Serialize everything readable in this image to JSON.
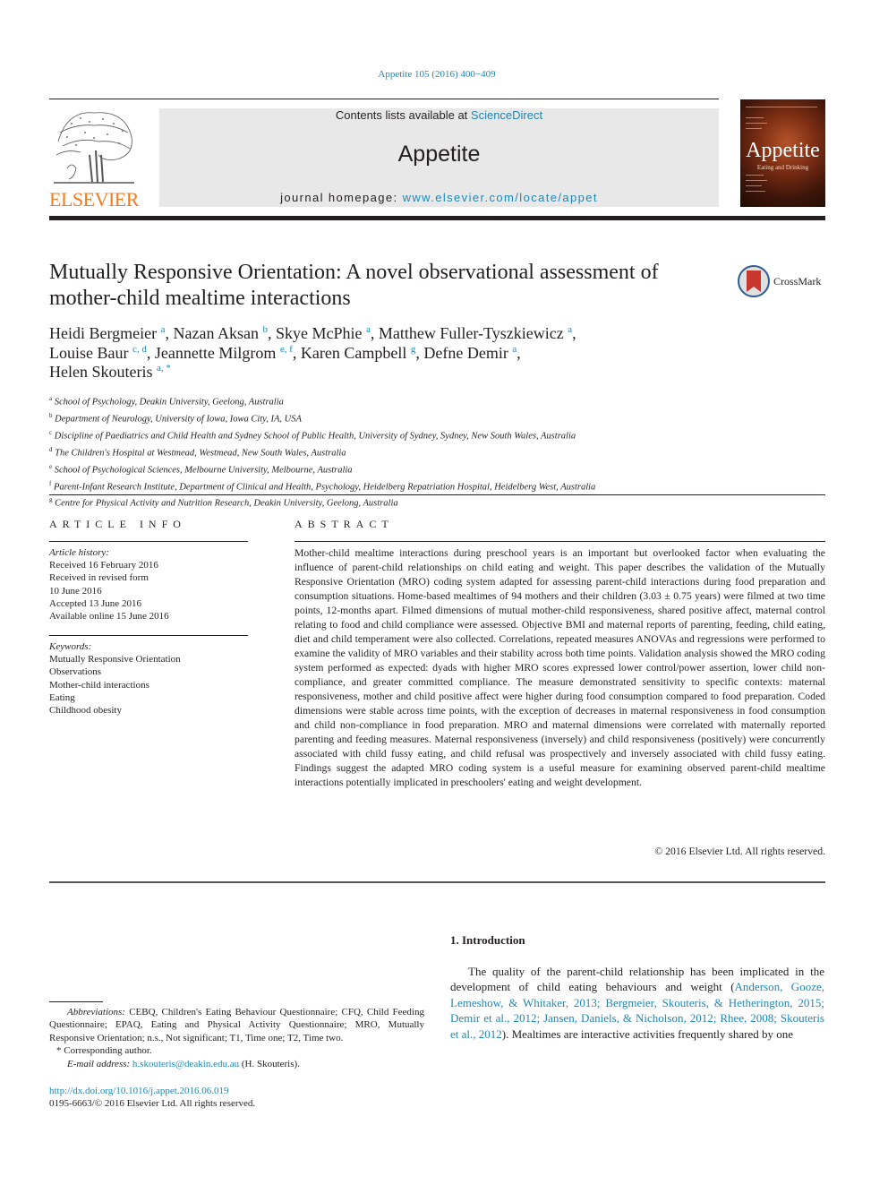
{
  "header": {
    "citation": "Appetite 105 (2016) 400−409",
    "contents_prefix": "Contents lists available at ",
    "contents_link": "ScienceDirect",
    "journal_name": "Appetite",
    "homepage_prefix": "journal homepage: ",
    "homepage_link": "www.elsevier.com/locate/appet",
    "publisher_logo_text": "ELSEVIER",
    "cover_title": "Appetite",
    "cover_subtitle": "Eating and Drinking"
  },
  "article": {
    "title": "Mutually Responsive Orientation: A novel observational assessment of mother-child mealtime interactions",
    "crossmark_label": "CrossMark",
    "authors": [
      {
        "name": "Heidi Bergmeier",
        "sup": "a",
        "sep": ", "
      },
      {
        "name": "Nazan Aksan",
        "sup": "b",
        "sep": ", "
      },
      {
        "name": "Skye McPhie",
        "sup": "a",
        "sep": ", "
      },
      {
        "name": "Matthew Fuller-Tyszkiewicz",
        "sup": "a",
        "sep": ","
      },
      {
        "name": "Louise Baur",
        "sup": "c, d",
        "sep": ", "
      },
      {
        "name": "Jeannette Milgrom",
        "sup": "e, f",
        "sep": ", "
      },
      {
        "name": "Karen Campbell",
        "sup": "g",
        "sep": ", "
      },
      {
        "name": "Defne Demir",
        "sup": "a",
        "sep": ","
      },
      {
        "name": "Helen Skouteris",
        "sup": "a, *",
        "sep": ""
      }
    ],
    "affiliations": [
      {
        "key": "a",
        "text": "School of Psychology, Deakin University, Geelong, Australia"
      },
      {
        "key": "b",
        "text": "Department of Neurology, University of Iowa, Iowa City, IA, USA"
      },
      {
        "key": "c",
        "text": "Discipline of Paediatrics and Child Health and Sydney School of Public Health, University of Sydney, Sydney, New South Wales, Australia"
      },
      {
        "key": "d",
        "text": "The Children's Hospital at Westmead, Westmead, New South Wales, Australia"
      },
      {
        "key": "e",
        "text": "School of Psychological Sciences, Melbourne University, Melbourne, Australia"
      },
      {
        "key": "f",
        "text": "Parent-Infant Research Institute, Department of Clinical and Health, Psychology, Heidelberg Repatriation Hospital, Heidelberg West, Australia"
      },
      {
        "key": "g",
        "text": "Centre for Physical Activity and Nutrition Research, Deakin University, Geelong, Australia"
      }
    ]
  },
  "article_info": {
    "heading": "ARTICLE INFO",
    "history_label": "Article history:",
    "history": [
      "Received 16 February 2016",
      "Received in revised form",
      "10 June 2016",
      "Accepted 13 June 2016",
      "Available online 15 June 2016"
    ],
    "keywords_label": "Keywords:",
    "keywords": [
      "Mutually Responsive Orientation",
      "Observations",
      "Mother-child interactions",
      "Eating",
      "Childhood obesity"
    ]
  },
  "abstract": {
    "heading": "ABSTRACT",
    "text": "Mother-child mealtime interactions during preschool years is an important but overlooked factor when evaluating the influence of parent-child relationships on child eating and weight. This paper describes the validation of the Mutually Responsive Orientation (MRO) coding system adapted for assessing parent-child interactions during food preparation and consumption situations. Home-based mealtimes of 94 mothers and their children (3.03 ± 0.75 years) were filmed at two time points, 12-months apart. Filmed dimensions of mutual mother-child responsiveness, shared positive affect, maternal control relating to food and child compliance were assessed. Objective BMI and maternal reports of parenting, feeding, child eating, diet and child temperament were also collected. Correlations, repeated measures ANOVAs and regressions were performed to examine the validity of MRO variables and their stability across both time points. Validation analysis showed the MRO coding system performed as expected: dyads with higher MRO scores expressed lower control/power assertion, lower child non-compliance, and greater committed compliance. The measure demonstrated sensitivity to specific contexts: maternal responsiveness, mother and child positive affect were higher during food consumption compared to food preparation. Coded dimensions were stable across time points, with the exception of decreases in maternal responsiveness in food consumption and child non-compliance in food prepara­tion. MRO and maternal dimensions were correlated with maternally reported parenting and feeding measures. Maternal responsiveness (inversely) and child responsiveness (positively) were concurrently associated with child fussy eating, and child refusal was prospectively and inversely associated with child fussy eating. Findings suggest the adapted MRO coding system is a useful measure for examining observed parent-child mealtime interactions potentially implicated in preschoolers' eating and weight development.",
    "copyright": "© 2016 Elsevier Ltd. All rights reserved."
  },
  "footnotes": {
    "abbreviations_label": "Abbreviations:",
    "abbreviations_text": " CEBQ, Children's Eating Behaviour Questionnaire; CFQ, Child Feeding Questionnaire; EPAQ, Eating and Physical Activity Questionnaire; MRO, Mutually Responsive Orientation; n.s., Not significant; T1, Time one; T2, Time two.",
    "corresponding": "* Corresponding author.",
    "email_label": "E-mail address:",
    "email": "h.skouteris@deakin.edu.au",
    "email_suffix": " (H. Skouteris).",
    "doi": "http://dx.doi.org/10.1016/j.appet.2016.06.019",
    "issn_line": "0195-6663/© 2016 Elsevier Ltd. All rights reserved."
  },
  "introduction": {
    "heading": "1.  Introduction",
    "text_before": "The quality of the parent-child relationship has been implicated in the development of child eating behaviours and weight (",
    "citations": "Anderson, Gooze, Lemeshow, & Whitaker, 2013; Bergmeier, Skouteris, & Hetherington, 2015; Demir et al., 2012; Jansen, Daniels, & Nicholson, 2012; Rhee, 2008; Skouteris et al., 2012",
    "text_after": "). Mealtimes are interactive activities frequently shared by one"
  },
  "colors": {
    "link": "#1f87b5",
    "elsevier_orange": "#f47b20",
    "masthead_bg": "#e8e8e8",
    "text": "#231f20"
  }
}
